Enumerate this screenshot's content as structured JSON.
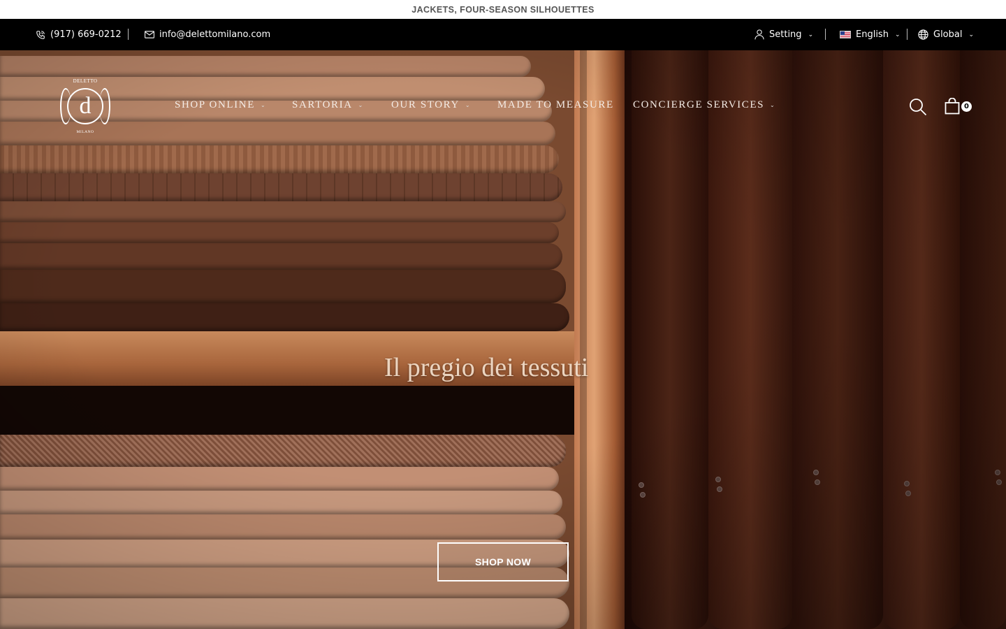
{
  "announcement": {
    "text": "JACKETS, FOUR-SEASON SILHOUETTES"
  },
  "topbar": {
    "phone": "(917) 669-0212",
    "email": "info@delettomilano.com",
    "setting_label": "Setting",
    "language_label": "English",
    "region_label": "Global"
  },
  "logo": {
    "top_text": "DELETTO",
    "letter": "d",
    "bottom_text": "MILANO"
  },
  "nav": {
    "items": [
      {
        "label": "SHOP ONLINE",
        "has_dropdown": true
      },
      {
        "label": "SARTORIA",
        "has_dropdown": true
      },
      {
        "label": "OUR STORY",
        "has_dropdown": true
      },
      {
        "label": "MADE TO MEASURE",
        "has_dropdown": false
      },
      {
        "label": "CONCIERGE SERVICES",
        "has_dropdown": true
      }
    ]
  },
  "cart": {
    "count": "0"
  },
  "hero": {
    "tagline": "Il pregio dei tessuti",
    "cta_label": "SHOP NOW"
  },
  "icons": [
    "phone-icon",
    "mail-icon",
    "user-icon",
    "us-flag-icon",
    "globe-icon",
    "search-icon",
    "shopping-bag-icon"
  ]
}
